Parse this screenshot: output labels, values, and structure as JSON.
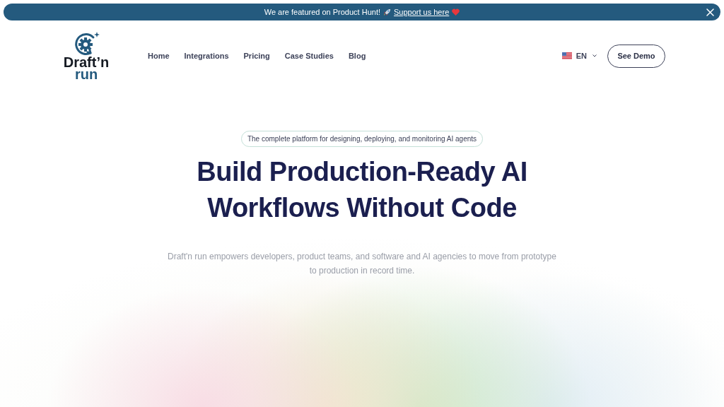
{
  "banner": {
    "text": "We are featured on Product Hunt!",
    "link": "Support us here"
  },
  "logo": {
    "line_1": "Draft’n",
    "line_2": "run"
  },
  "nav": {
    "items": [
      {
        "label": "Home"
      },
      {
        "label": "Integrations"
      },
      {
        "label": "Pricing"
      },
      {
        "label": "Case Studies"
      },
      {
        "label": "Blog"
      }
    ]
  },
  "language": {
    "label": "EN"
  },
  "cta": {
    "label": "See Demo"
  },
  "hero": {
    "badge": "The complete platform for designing, deploying, and monitoring AI agents",
    "title_lines": [
      "Build Production-Ready AI",
      "Workflows Without Code"
    ],
    "subtitle": "Draft'n run empowers developers, product teams, and software and AI agencies to move from prototype to production in record time."
  }
}
